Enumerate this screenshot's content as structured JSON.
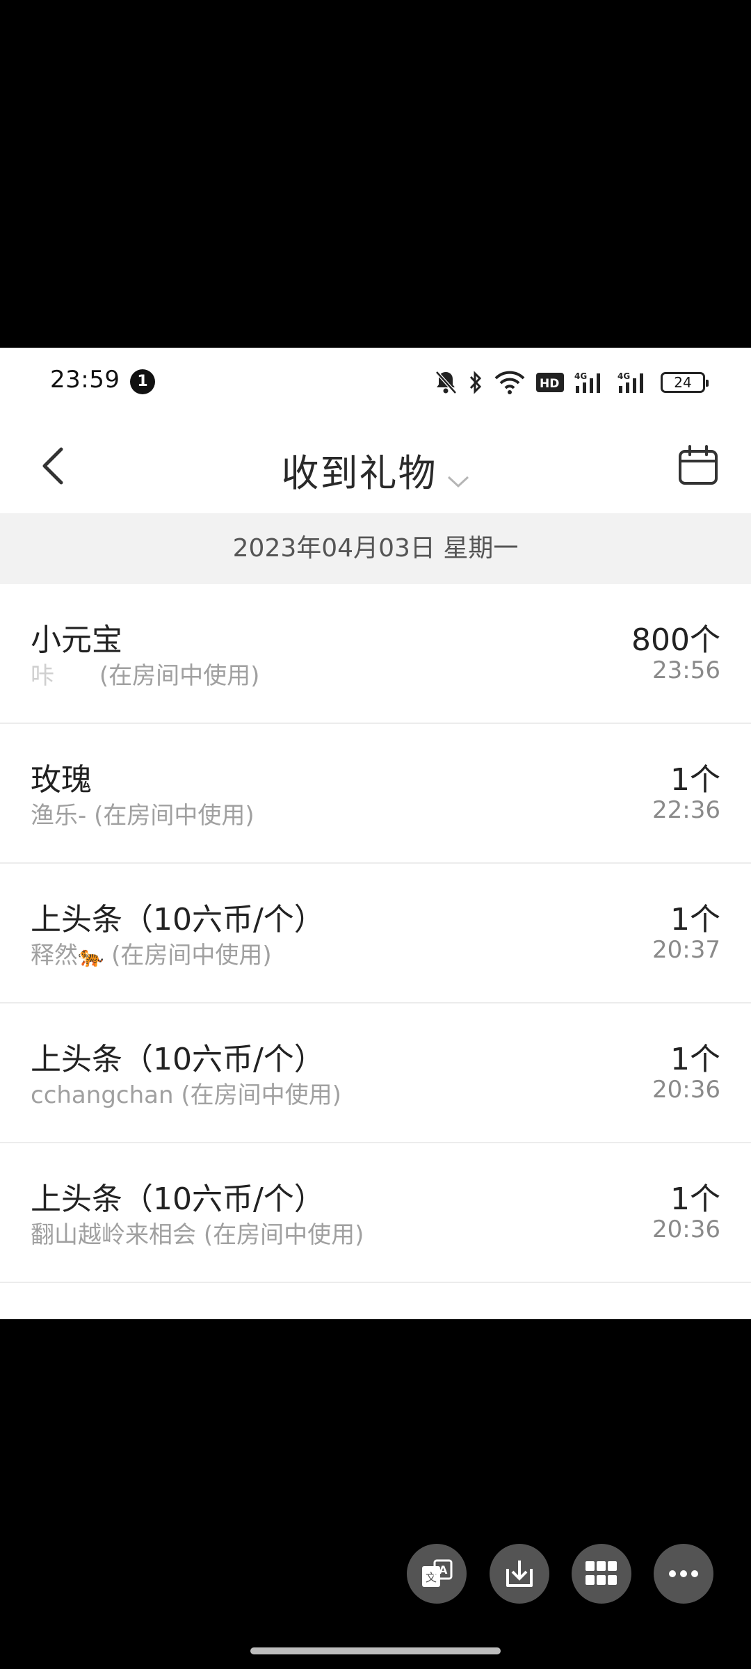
{
  "status_bar": {
    "time": "23:59",
    "notification_count": "1",
    "battery": "24",
    "hd_label": "HD"
  },
  "header": {
    "title": "收到礼物"
  },
  "date_bar": {
    "date": "2023年04月03日 星期一"
  },
  "gifts": [
    {
      "name": "小元宝",
      "sender": "咔 ",
      "context": "(在房间中使用)",
      "count": "800个",
      "time": "23:56"
    },
    {
      "name": "玫瑰",
      "sender": "渔乐-",
      "context": "(在房间中使用)",
      "count": "1个",
      "time": "22:36"
    },
    {
      "name": "上头条（10六币/个）",
      "sender": "释然",
      "sender_emoji": "🐅",
      "context": "(在房间中使用)",
      "count": "1个",
      "time": "20:37"
    },
    {
      "name": "上头条（10六币/个）",
      "sender": "cchangchan",
      "context": "(在房间中使用)",
      "count": "1个",
      "time": "20:36"
    },
    {
      "name": "上头条（10六币/个）",
      "sender": "翻山越岭来相会",
      "context": "(在房间中使用)",
      "count": "1个",
      "time": "20:36"
    }
  ],
  "floating_buttons": [
    {
      "icon": "translate-icon"
    },
    {
      "icon": "download-icon"
    },
    {
      "icon": "grid-icon"
    },
    {
      "icon": "more-icon"
    }
  ]
}
